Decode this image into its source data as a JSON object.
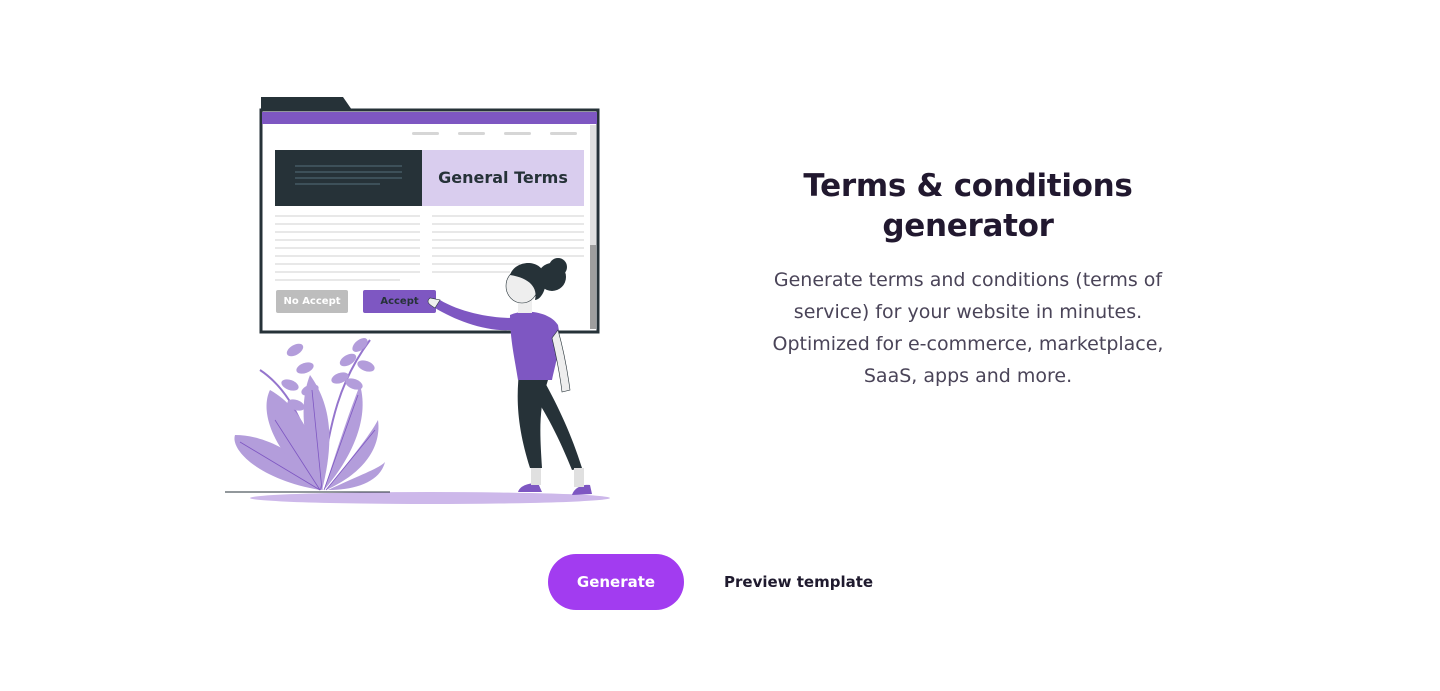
{
  "hero": {
    "title_line1": "Terms & conditions",
    "title_line2": "generator",
    "description": "Generate terms and conditions (terms of service) for your website in minutes. Optimized for e-commerce, marketplace, SaaS, apps and more."
  },
  "illustration": {
    "heading": "General Terms",
    "no_accept_label": "No Accept",
    "accept_label": "Accept"
  },
  "actions": {
    "generate_label": "Generate",
    "preview_label": "Preview template"
  },
  "colors": {
    "accent": "#a23cf0",
    "illustration_purple": "#7e57c2",
    "illustration_light": "#d9cdee",
    "dark": "#263238"
  }
}
